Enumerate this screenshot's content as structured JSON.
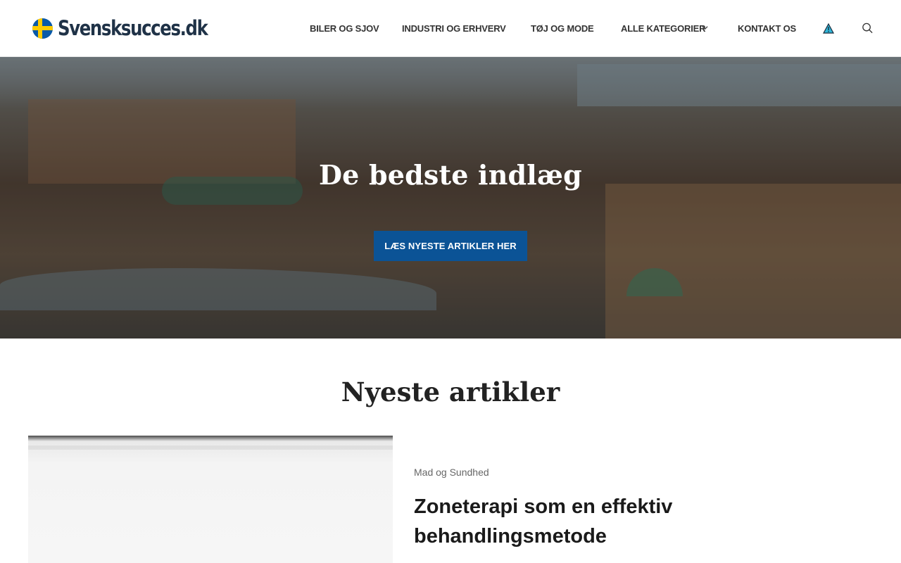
{
  "header": {
    "logo_text": "Svensksucces.dk",
    "nav": [
      {
        "label": "BILER OG SJOV"
      },
      {
        "label": "INDUSTRI OG ERHVERV"
      },
      {
        "label": "TØJ OG MODE"
      },
      {
        "label": "ALLE KATEGORIER",
        "has_dropdown": true
      },
      {
        "label": "KONTAKT OS"
      }
    ],
    "icons": [
      "warning-icon",
      "search-icon",
      "chevron-down-icon",
      "sweden-flag-icon"
    ]
  },
  "hero": {
    "title": "De bedste indlæg",
    "button_label": "LÆS NYESTE ARTIKLER HER"
  },
  "latest": {
    "section_title": "Nyeste artikler",
    "articles": [
      {
        "category": "Mad og Sundhed",
        "title": "Zoneterapi som en effektiv behandlingsmetode"
      }
    ]
  },
  "colors": {
    "button_bg": "#0b5396",
    "logo_text": "#1f3247",
    "flag_blue": "#0a5aa8",
    "flag_yellow": "#ffcc00"
  }
}
